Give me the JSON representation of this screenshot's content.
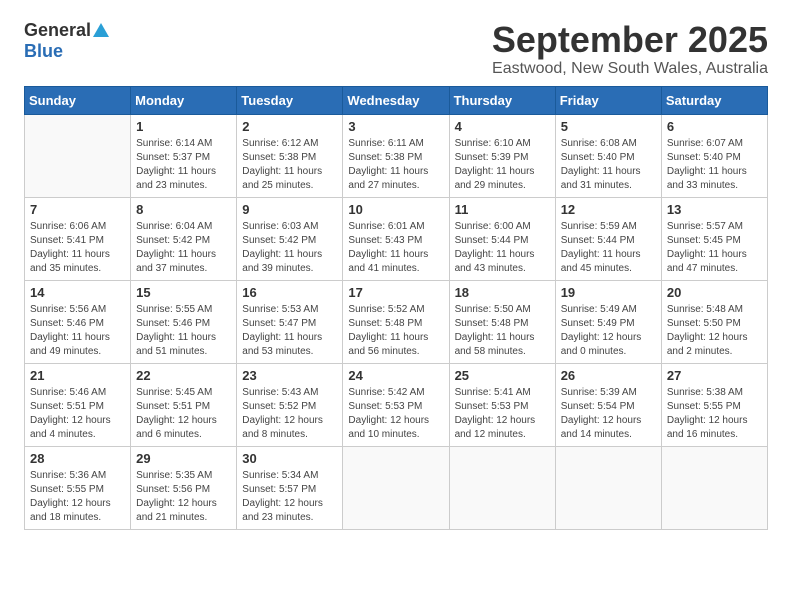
{
  "logo": {
    "general": "General",
    "blue": "Blue"
  },
  "title": "September 2025",
  "location": "Eastwood, New South Wales, Australia",
  "weekdays": [
    "Sunday",
    "Monday",
    "Tuesday",
    "Wednesday",
    "Thursday",
    "Friday",
    "Saturday"
  ],
  "weeks": [
    [
      {
        "day": "",
        "info": ""
      },
      {
        "day": "1",
        "info": "Sunrise: 6:14 AM\nSunset: 5:37 PM\nDaylight: 11 hours\nand 23 minutes."
      },
      {
        "day": "2",
        "info": "Sunrise: 6:12 AM\nSunset: 5:38 PM\nDaylight: 11 hours\nand 25 minutes."
      },
      {
        "day": "3",
        "info": "Sunrise: 6:11 AM\nSunset: 5:38 PM\nDaylight: 11 hours\nand 27 minutes."
      },
      {
        "day": "4",
        "info": "Sunrise: 6:10 AM\nSunset: 5:39 PM\nDaylight: 11 hours\nand 29 minutes."
      },
      {
        "day": "5",
        "info": "Sunrise: 6:08 AM\nSunset: 5:40 PM\nDaylight: 11 hours\nand 31 minutes."
      },
      {
        "day": "6",
        "info": "Sunrise: 6:07 AM\nSunset: 5:40 PM\nDaylight: 11 hours\nand 33 minutes."
      }
    ],
    [
      {
        "day": "7",
        "info": "Sunrise: 6:06 AM\nSunset: 5:41 PM\nDaylight: 11 hours\nand 35 minutes."
      },
      {
        "day": "8",
        "info": "Sunrise: 6:04 AM\nSunset: 5:42 PM\nDaylight: 11 hours\nand 37 minutes."
      },
      {
        "day": "9",
        "info": "Sunrise: 6:03 AM\nSunset: 5:42 PM\nDaylight: 11 hours\nand 39 minutes."
      },
      {
        "day": "10",
        "info": "Sunrise: 6:01 AM\nSunset: 5:43 PM\nDaylight: 11 hours\nand 41 minutes."
      },
      {
        "day": "11",
        "info": "Sunrise: 6:00 AM\nSunset: 5:44 PM\nDaylight: 11 hours\nand 43 minutes."
      },
      {
        "day": "12",
        "info": "Sunrise: 5:59 AM\nSunset: 5:44 PM\nDaylight: 11 hours\nand 45 minutes."
      },
      {
        "day": "13",
        "info": "Sunrise: 5:57 AM\nSunset: 5:45 PM\nDaylight: 11 hours\nand 47 minutes."
      }
    ],
    [
      {
        "day": "14",
        "info": "Sunrise: 5:56 AM\nSunset: 5:46 PM\nDaylight: 11 hours\nand 49 minutes."
      },
      {
        "day": "15",
        "info": "Sunrise: 5:55 AM\nSunset: 5:46 PM\nDaylight: 11 hours\nand 51 minutes."
      },
      {
        "day": "16",
        "info": "Sunrise: 5:53 AM\nSunset: 5:47 PM\nDaylight: 11 hours\nand 53 minutes."
      },
      {
        "day": "17",
        "info": "Sunrise: 5:52 AM\nSunset: 5:48 PM\nDaylight: 11 hours\nand 56 minutes."
      },
      {
        "day": "18",
        "info": "Sunrise: 5:50 AM\nSunset: 5:48 PM\nDaylight: 11 hours\nand 58 minutes."
      },
      {
        "day": "19",
        "info": "Sunrise: 5:49 AM\nSunset: 5:49 PM\nDaylight: 12 hours\nand 0 minutes."
      },
      {
        "day": "20",
        "info": "Sunrise: 5:48 AM\nSunset: 5:50 PM\nDaylight: 12 hours\nand 2 minutes."
      }
    ],
    [
      {
        "day": "21",
        "info": "Sunrise: 5:46 AM\nSunset: 5:51 PM\nDaylight: 12 hours\nand 4 minutes."
      },
      {
        "day": "22",
        "info": "Sunrise: 5:45 AM\nSunset: 5:51 PM\nDaylight: 12 hours\nand 6 minutes."
      },
      {
        "day": "23",
        "info": "Sunrise: 5:43 AM\nSunset: 5:52 PM\nDaylight: 12 hours\nand 8 minutes."
      },
      {
        "day": "24",
        "info": "Sunrise: 5:42 AM\nSunset: 5:53 PM\nDaylight: 12 hours\nand 10 minutes."
      },
      {
        "day": "25",
        "info": "Sunrise: 5:41 AM\nSunset: 5:53 PM\nDaylight: 12 hours\nand 12 minutes."
      },
      {
        "day": "26",
        "info": "Sunrise: 5:39 AM\nSunset: 5:54 PM\nDaylight: 12 hours\nand 14 minutes."
      },
      {
        "day": "27",
        "info": "Sunrise: 5:38 AM\nSunset: 5:55 PM\nDaylight: 12 hours\nand 16 minutes."
      }
    ],
    [
      {
        "day": "28",
        "info": "Sunrise: 5:36 AM\nSunset: 5:55 PM\nDaylight: 12 hours\nand 18 minutes."
      },
      {
        "day": "29",
        "info": "Sunrise: 5:35 AM\nSunset: 5:56 PM\nDaylight: 12 hours\nand 21 minutes."
      },
      {
        "day": "30",
        "info": "Sunrise: 5:34 AM\nSunset: 5:57 PM\nDaylight: 12 hours\nand 23 minutes."
      },
      {
        "day": "",
        "info": ""
      },
      {
        "day": "",
        "info": ""
      },
      {
        "day": "",
        "info": ""
      },
      {
        "day": "",
        "info": ""
      }
    ]
  ]
}
